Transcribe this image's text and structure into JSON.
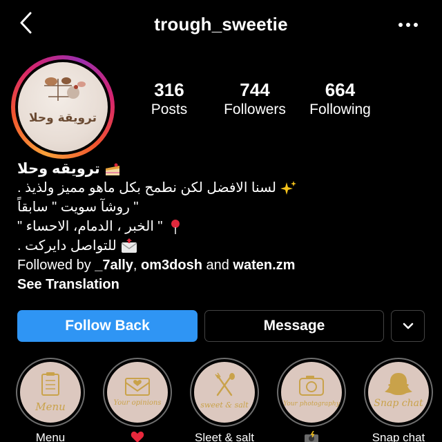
{
  "header": {
    "username": "trough_sweetie",
    "back_icon": "chevron-left-icon",
    "more_icon": "more-horizontal-icon"
  },
  "profile": {
    "avatar_text": "ترويقة وحلا"
  },
  "stats": [
    {
      "number": "316",
      "label": "Posts"
    },
    {
      "number": "744",
      "label": "Followers"
    },
    {
      "number": "664",
      "label": "Following"
    }
  ],
  "bio": {
    "name": "ترويقه وحلا",
    "lines": [
      "لسنا الافضل لكن نطمح بكل ماهو مميز ولذيذ .",
      "\" روشآ سويت \" سابقاً",
      "\" الخبر ، الدمام، الاحساء \"",
      "للتواصل دايركت ."
    ],
    "followed_by_prefix": "Followed by ",
    "followed_by_user1": "_7ally",
    "followed_by_sep": ", ",
    "followed_by_user2": "om3dosh",
    "followed_by_and": " and ",
    "followed_by_user3": "waten.zm",
    "see_translation": "See Translation"
  },
  "actions": {
    "follow_back": "Follow Back",
    "message": "Message"
  },
  "highlights": [
    {
      "label": "Menu",
      "cover_text": "Menu"
    },
    {
      "label": "",
      "cover_text": "Your opinions"
    },
    {
      "label": "Sleet & salt",
      "cover_text": "sweet & salt"
    },
    {
      "label": "",
      "cover_text": "Your photography"
    },
    {
      "label": "Snap chat",
      "cover_text": "Snap chat"
    }
  ],
  "colors": {
    "follow_button": "#2f95f4",
    "gold": "#c9a24a",
    "highlight_bg": "#dcc8bf"
  }
}
